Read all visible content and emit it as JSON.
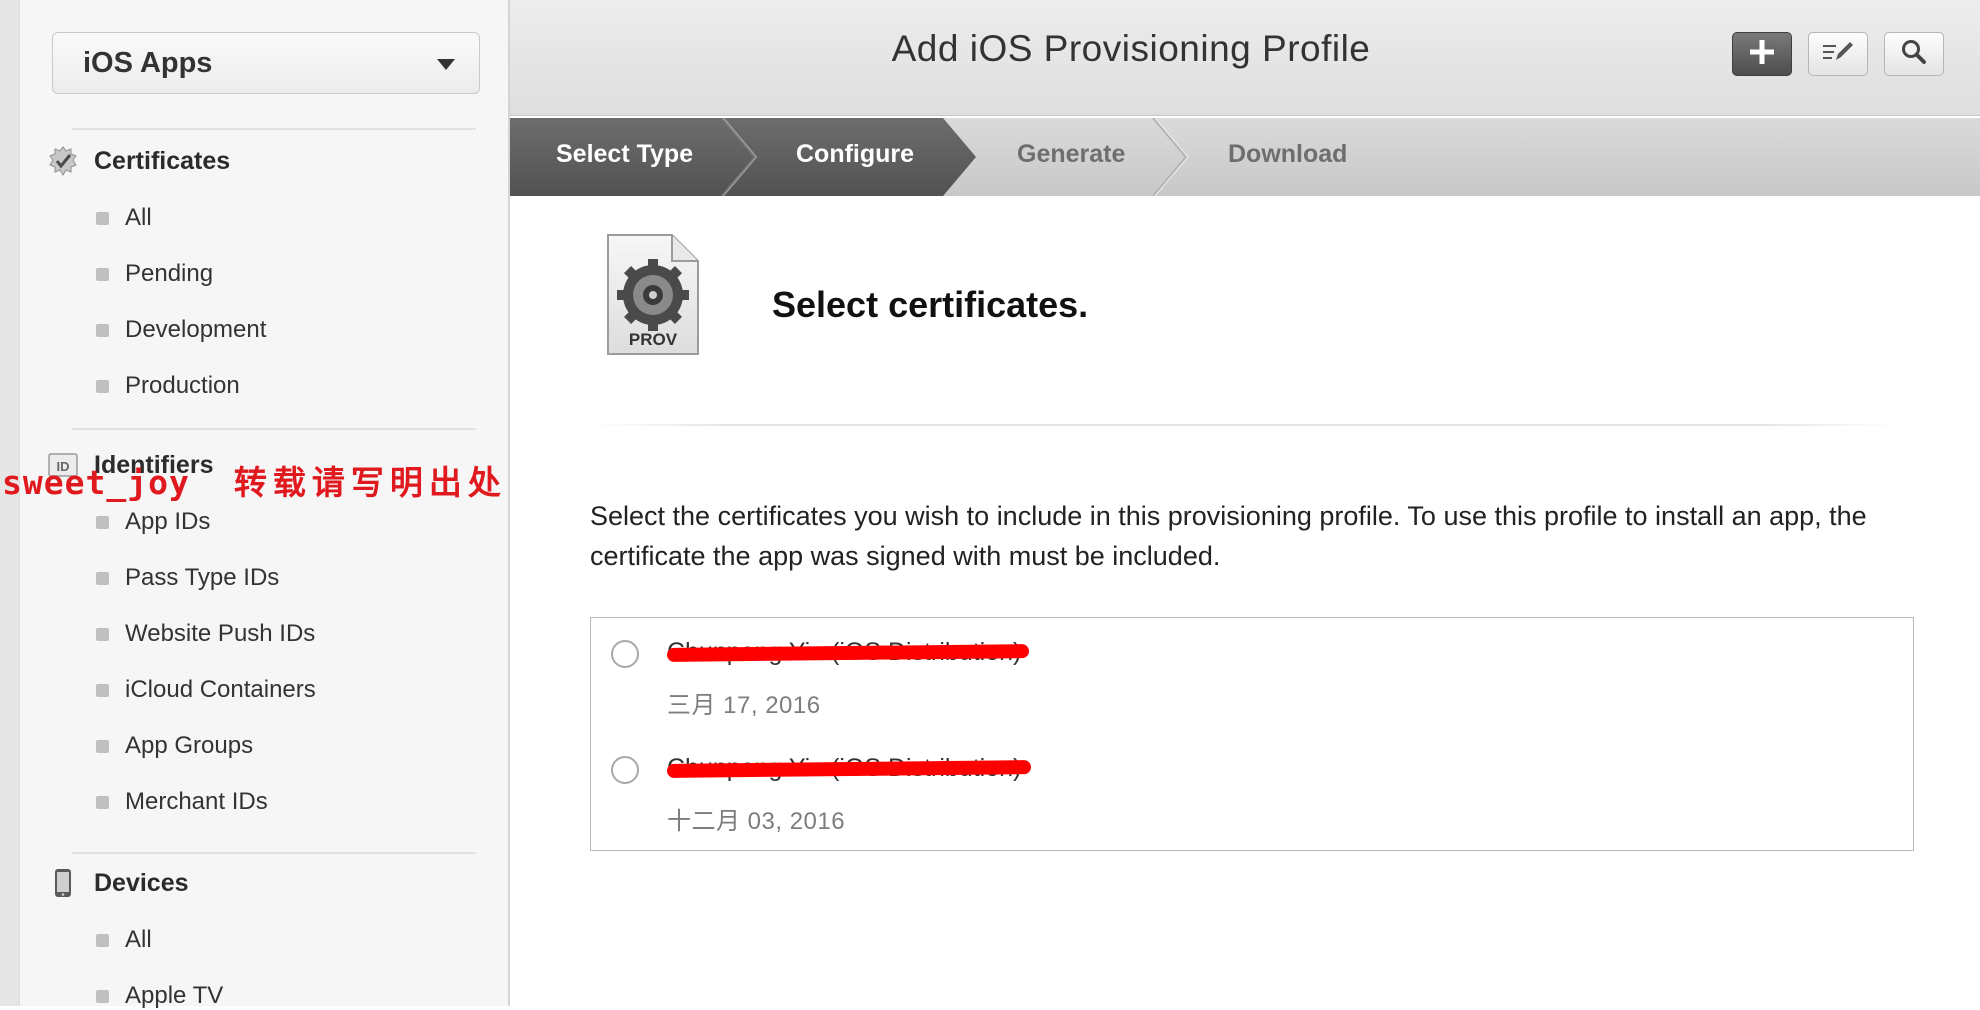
{
  "platform_select": {
    "value": "iOS Apps"
  },
  "sidebar": {
    "certificates": {
      "title": "Certificates",
      "items": [
        "All",
        "Pending",
        "Development",
        "Production"
      ]
    },
    "identifiers": {
      "title": "Identifiers",
      "icon_text": "ID",
      "items": [
        "App IDs",
        "Pass Type IDs",
        "Website Push IDs",
        "iCloud Containers",
        "App Groups",
        "Merchant IDs"
      ]
    },
    "devices": {
      "title": "Devices",
      "items": [
        "All",
        "Apple TV"
      ]
    }
  },
  "watermark": {
    "name": "sweet_joy",
    "note": "转载请写明出处"
  },
  "header": {
    "title": "Add iOS Provisioning Profile",
    "icons": [
      "plus-icon",
      "edit-icon",
      "search-icon"
    ]
  },
  "steps": [
    {
      "label": "Select Type",
      "state": "done"
    },
    {
      "label": "Configure",
      "state": "current"
    },
    {
      "label": "Generate",
      "state": "upcoming"
    },
    {
      "label": "Download",
      "state": "upcoming"
    }
  ],
  "main": {
    "icon_label": "PROV",
    "heading": "Select certificates.",
    "description": "Select the certificates you wish to include in this provisioning profile. To use this profile to install an app, the certificate the app was signed with must be included.",
    "certificates": [
      {
        "name": "Chunpeng Yin (iOS Distribution)",
        "date": "三月 17, 2016",
        "selected": false,
        "redacted": true
      },
      {
        "name": "Chunpeng Yin (iOS Distribution)",
        "date": "十二月 03, 2016",
        "selected": false,
        "redacted": true
      }
    ]
  },
  "colors": {
    "step_active": "#5d5d5d",
    "step_inactive": "#d2d2d2",
    "redaction": "#ff0000",
    "watermark": "#e0191e"
  }
}
